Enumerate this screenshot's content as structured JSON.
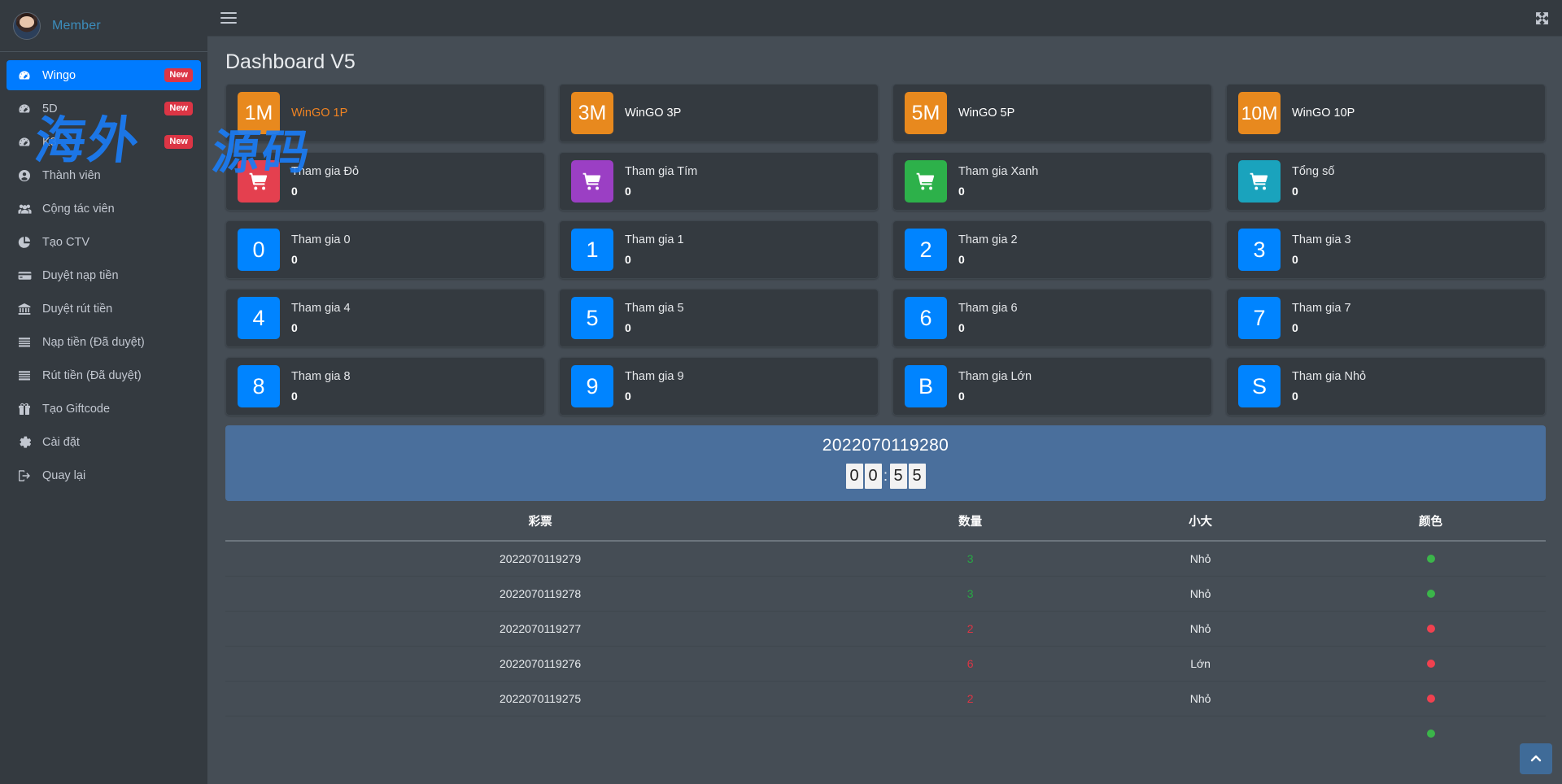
{
  "brand": {
    "name": "Member",
    "avatar_icon": "user-avatar"
  },
  "topbar": {
    "menu_icon": "hamburger-icon",
    "fullscreen_icon": "expand-arrows-icon"
  },
  "page": {
    "title": "Dashboard V5"
  },
  "watermark": {
    "line1": "海外",
    "line2": "源码"
  },
  "sidebar": {
    "items": [
      {
        "label": "Wingo",
        "icon": "dashboard-icon",
        "badge": "New",
        "active": true
      },
      {
        "label": "5D",
        "icon": "dashboard-icon",
        "badge": "New",
        "active": false
      },
      {
        "label": "K3",
        "icon": "dashboard-icon",
        "badge": "New",
        "active": false
      },
      {
        "label": "Thành viên",
        "icon": "user-circle-icon",
        "badge": "",
        "active": false
      },
      {
        "label": "Cộng tác viên",
        "icon": "users-icon",
        "badge": "",
        "active": false
      },
      {
        "label": "Tạo CTV",
        "icon": "pie-chart-icon",
        "badge": "",
        "active": false
      },
      {
        "label": "Duyệt nạp tiền",
        "icon": "credit-card-icon",
        "badge": "",
        "active": false
      },
      {
        "label": "Duyệt rút tiền",
        "icon": "bank-icon",
        "badge": "",
        "active": false
      },
      {
        "label": "Nạp tiền (Đã duyệt)",
        "icon": "list-icon",
        "badge": "",
        "active": false
      },
      {
        "label": "Rút tiền (Đã duyệt)",
        "icon": "list-icon",
        "badge": "",
        "active": false
      },
      {
        "label": "Tạo Giftcode",
        "icon": "gift-icon",
        "badge": "",
        "active": false
      },
      {
        "label": "Cài đặt",
        "icon": "gear-icon",
        "badge": "",
        "active": false
      },
      {
        "label": "Quay lại",
        "icon": "sign-out-icon",
        "badge": "",
        "active": false
      }
    ]
  },
  "game_tabs": [
    {
      "tile": "1M",
      "label": "WinGO 1P",
      "color": "#e8891e",
      "active": true
    },
    {
      "tile": "3M",
      "label": "WinGO 3P",
      "color": "#e8891e",
      "active": false
    },
    {
      "tile": "5M",
      "label": "WinGO 5P",
      "color": "#e8891e",
      "active": false
    },
    {
      "tile": "10M",
      "label": "WinGO 10P",
      "color": "#e8891e",
      "active": false
    }
  ],
  "bet_stats": [
    {
      "tile": "cart-icon",
      "title": "Tham gia Đỏ",
      "value": "0",
      "color": "#e4404f"
    },
    {
      "tile": "cart-icon",
      "title": "Tham gia Tím",
      "value": "0",
      "color": "#9b3fc4"
    },
    {
      "tile": "cart-icon",
      "title": "Tham gia Xanh",
      "value": "0",
      "color": "#2db14a"
    },
    {
      "tile": "cart-icon",
      "title": "Tổng số",
      "value": "0",
      "color": "#1aa3bd"
    }
  ],
  "number_stats": [
    {
      "tile": "0",
      "title": "Tham gia 0",
      "value": "0",
      "color": "#0084ff"
    },
    {
      "tile": "1",
      "title": "Tham gia 1",
      "value": "0",
      "color": "#0084ff"
    },
    {
      "tile": "2",
      "title": "Tham gia 2",
      "value": "0",
      "color": "#0084ff"
    },
    {
      "tile": "3",
      "title": "Tham gia 3",
      "value": "0",
      "color": "#0084ff"
    },
    {
      "tile": "4",
      "title": "Tham gia 4",
      "value": "0",
      "color": "#0084ff"
    },
    {
      "tile": "5",
      "title": "Tham gia 5",
      "value": "0",
      "color": "#0084ff"
    },
    {
      "tile": "6",
      "title": "Tham gia 6",
      "value": "0",
      "color": "#0084ff"
    },
    {
      "tile": "7",
      "title": "Tham gia 7",
      "value": "0",
      "color": "#0084ff"
    },
    {
      "tile": "8",
      "title": "Tham gia 8",
      "value": "0",
      "color": "#0084ff"
    },
    {
      "tile": "9",
      "title": "Tham gia 9",
      "value": "0",
      "color": "#0084ff"
    },
    {
      "tile": "B",
      "title": "Tham gia Lớn",
      "value": "0",
      "color": "#0084ff"
    },
    {
      "tile": "S",
      "title": "Tham gia Nhỏ",
      "value": "0",
      "color": "#0084ff"
    }
  ],
  "banner": {
    "issue": "2022070119280",
    "countdown": {
      "d1": "0",
      "d2": "0",
      "separator": ":",
      "d3": "5",
      "d4": "5"
    }
  },
  "table": {
    "headers": [
      "彩票",
      "数量",
      "小大",
      "颜色"
    ],
    "rows": [
      {
        "ticket": "2022070119279",
        "amount": "3",
        "amount_color": "green",
        "size": "Nhỏ",
        "color": "green"
      },
      {
        "ticket": "2022070119278",
        "amount": "3",
        "amount_color": "green",
        "size": "Nhỏ",
        "color": "green"
      },
      {
        "ticket": "2022070119277",
        "amount": "2",
        "amount_color": "red",
        "size": "Nhỏ",
        "color": "red"
      },
      {
        "ticket": "2022070119276",
        "amount": "6",
        "amount_color": "red",
        "size": "Lớn",
        "color": "red"
      },
      {
        "ticket": "2022070119275",
        "amount": "2",
        "amount_color": "red",
        "size": "Nhỏ",
        "color": "red"
      },
      {
        "ticket": "",
        "amount": "",
        "amount_color": "green",
        "size": "",
        "color": "green"
      }
    ]
  },
  "scroll_top": {
    "icon": "chevron-up-icon"
  }
}
